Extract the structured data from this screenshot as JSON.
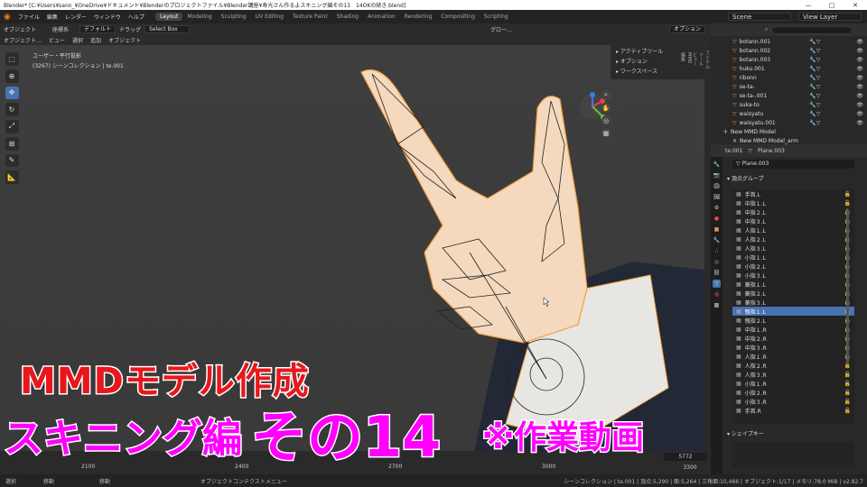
{
  "titlebar": {
    "title": "Blender* [C:¥Users¥sann_¥OneDrive¥ドキュメント¥Blenderのプロジェクトファイル¥Blender講座¥寿光さん作るよスキニング編その13　14OKの続き.blend]",
    "minimize": "—",
    "maximize": "□",
    "close": "✕"
  },
  "topbar": {
    "logo": "blender-logo-icon",
    "menus": [
      "ファイル",
      "編集",
      "レンダー",
      "ウィンドウ",
      "ヘルプ"
    ],
    "workspaces": [
      "Layout",
      "Modeling",
      "Sculpting",
      "UV Editing",
      "Texture Paint",
      "Shading",
      "Animation",
      "Rendering",
      "Compositing",
      "Scripting"
    ],
    "active_workspace": "Layout",
    "scene_label": "Scene",
    "view_layer_label": "View Layer"
  },
  "header": {
    "mode": "オブジェクト",
    "coord": "座標系",
    "default": "デフォルト",
    "drag": "ドラッグ",
    "select_box": "Select Box",
    "global": "グロー…",
    "options": "オプション"
  },
  "header2": {
    "menus": [
      "オブジェクト…",
      "ビュー",
      "選択",
      "追加",
      "オブジェクト"
    ]
  },
  "viewport": {
    "info_line1": "ユーザー・平行投影",
    "info_line2": "(3267) シーンコレクション | te.001",
    "npanel": [
      "アクティブツール",
      "オプション",
      "ワークスペース"
    ]
  },
  "right_tabs": [
    "アイテム",
    "ツール",
    "ビュー",
    "MMD",
    "編集"
  ],
  "outliner": {
    "search_placeholder": "",
    "items": [
      {
        "name": "botann.001"
      },
      {
        "name": "botann.002"
      },
      {
        "name": "botann.003"
      },
      {
        "name": "huku.001"
      },
      {
        "name": "ribonn"
      },
      {
        "name": "se-ta-"
      },
      {
        "name": "se-ta-.001"
      },
      {
        "name": "suka-to"
      },
      {
        "name": "waisyatu"
      },
      {
        "name": "waisyatu.001"
      },
      {
        "name": "New MMD Model"
      },
      {
        "name": "New MMD Model_arm"
      }
    ]
  },
  "properties": {
    "object": "te.001",
    "mesh": "Plane.003",
    "mesh_field": "Plane.003",
    "vg_title": "頂点グループ",
    "vertex_groups": [
      "手首.L",
      "中指１.L",
      "中指２.L",
      "中指３.L",
      "人指１.L",
      "人指２.L",
      "人指３.L",
      "小指１.L",
      "小指２.L",
      "小指３.L",
      "薬指１.L",
      "薬指２.L",
      "薬指３.L",
      "親指１.L",
      "親指２.L",
      "中指１.R",
      "中指２.R",
      "中指３.R",
      "人指１.R",
      "人指２.R",
      "人指３.R",
      "小指１.R",
      "小指２.R",
      "小指３.R",
      "手首.R"
    ],
    "selected_group": "親指１.L",
    "shape_keys_title": "シェイプキー"
  },
  "timeline": {
    "frame_a": "5772",
    "frame_b": "3300",
    "ruler": [
      "2100",
      "2400",
      "2700",
      "3000",
      "3300"
    ]
  },
  "statusbar": {
    "left1": "選択",
    "left2": "移動",
    "left3": "移動",
    "context": "オブジェクトコンテクストメニュー",
    "right": "シーンコレクション | te.001 | 頂点:5,290 | 面:5,264 | 三角面:10,466 | オブジェクト:1/17 | メモリ:78.0 MiB | v2.82.7"
  },
  "caption": {
    "line1": "MMDモデル作成",
    "line2a": "スキニング編",
    "line2b": "その14",
    "line3": "※作業動画"
  },
  "colors": {
    "accent": "#4772b3",
    "caption_red": "#e8171c",
    "caption_magenta": "#ff00ff",
    "mesh_orange": "#e4904a"
  }
}
